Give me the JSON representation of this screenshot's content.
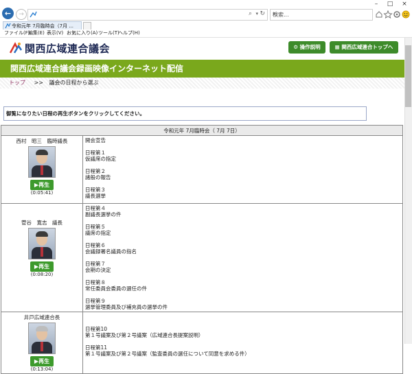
{
  "browser": {
    "window_controls": [
      "–",
      "□",
      "×"
    ],
    "search_placeholder": "検索...",
    "address_icons": [
      "⌕",
      "▾",
      "↻"
    ],
    "tab_title": "令和元年 7月臨時会（7月 ...",
    "menu": [
      "ファイル(F)",
      "編集(E)",
      "表示(V)",
      "お気に入り(A)",
      "ツール(T)",
      "ヘルプ(H)"
    ]
  },
  "site": {
    "logo_text": "関西広域連合議会",
    "buttons": {
      "guide": "操作説明",
      "top": "関西広域連合トップへ"
    },
    "banner_title": "関西広域連合議会録画映像インターネット配信",
    "breadcrumb": {
      "home": "トップ",
      "sep": ">>",
      "current": "議会の日程から選ぶ"
    },
    "instruction": "御覧になりたい日程の再生ボタンをクリックしてください。"
  },
  "session": {
    "title": "令和元年 7月臨時会（ 7月 7日）",
    "play_label": "再生",
    "rows": [
      {
        "speaker": "西村　昭三　臨時議長",
        "time": "(0:05:41)",
        "agenda": [
          "開会宣告",
          "",
          "日程第１",
          "仮議席の指定",
          "",
          "日程第２",
          "諸般の報告",
          "",
          "日程第３",
          "議長選挙"
        ]
      },
      {
        "speaker": "\n菅谷　寛志　議長",
        "time": "(0:08:20)",
        "agenda": [
          "日程第４",
          "副議長選挙の件",
          "",
          "日程第５",
          "議席の指定",
          "",
          "日程第６",
          "会議録署名議員の指名",
          "",
          "日程第７",
          "会期の決定",
          "",
          "日程第８",
          "常任委員会委員の選任の件",
          "",
          "日程第９",
          "選挙管理委員及び補充員の選挙の件"
        ]
      },
      {
        "speaker": "井戸広域連合長",
        "time": "(0:13:04)",
        "agenda": [
          "",
          "",
          "日程第10",
          "第１号議案及び第２号議案（広域連合長提案説明）",
          "",
          "日程第11",
          "第１号議案及び第２号議案（監査委員の選任について同意を求める件）"
        ]
      }
    ]
  },
  "colors": {
    "banner": "#7aa81c",
    "button": "#3d8b2a",
    "play": "#3d9a2c"
  }
}
